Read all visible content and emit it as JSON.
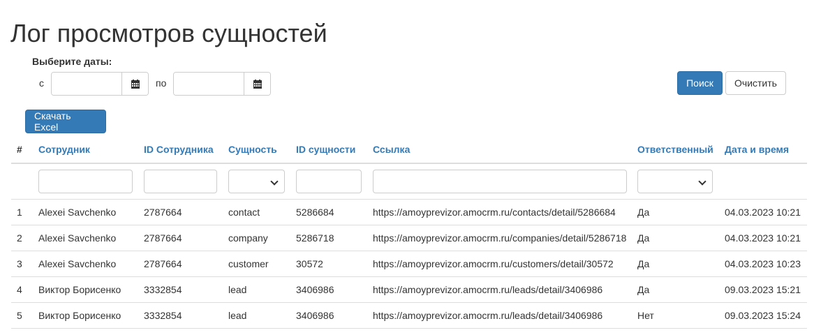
{
  "title": "Лог просмотров сущностей",
  "filter": {
    "dates_label": "Выберите даты:",
    "from_label": "с",
    "to_label": "по",
    "from_value": "",
    "to_value": "",
    "search_label": "Поиск",
    "clear_label": "Очистить",
    "calendar_icon": "calendar-icon"
  },
  "download_label": "Скачать Excel",
  "table": {
    "headers": [
      "#",
      "Сотрудник",
      "ID Сотрудника",
      "Сущность",
      "ID сущности",
      "Ссылка",
      "Ответственный",
      "Дата и время"
    ],
    "rows": [
      [
        "1",
        "Alexei Savchenko",
        "2787664",
        "contact",
        "5286684",
        "https://amoyprevizor.amocrm.ru/contacts/detail/5286684",
        "Да",
        "04.03.2023 10:21"
      ],
      [
        "2",
        "Alexei Savchenko",
        "2787664",
        "company",
        "5286718",
        "https://amoyprevizor.amocrm.ru/companies/detail/5286718",
        "Да",
        "04.03.2023 10:21"
      ],
      [
        "3",
        "Alexei Savchenko",
        "2787664",
        "customer",
        "30572",
        "https://amoyprevizor.amocrm.ru/customers/detail/30572",
        "Да",
        "04.03.2023 10:23"
      ],
      [
        "4",
        "Виктор Борисенко",
        "3332854",
        "lead",
        "3406986",
        "https://amoyprevizor.amocrm.ru/leads/detail/3406986",
        "Да",
        "09.03.2023 15:21"
      ],
      [
        "5",
        "Виктор Борисенко",
        "3332854",
        "lead",
        "3406986",
        "https://amoyprevizor.amocrm.ru/leads/detail/3406986",
        "Нет",
        "09.03.2023 15:24"
      ]
    ]
  }
}
